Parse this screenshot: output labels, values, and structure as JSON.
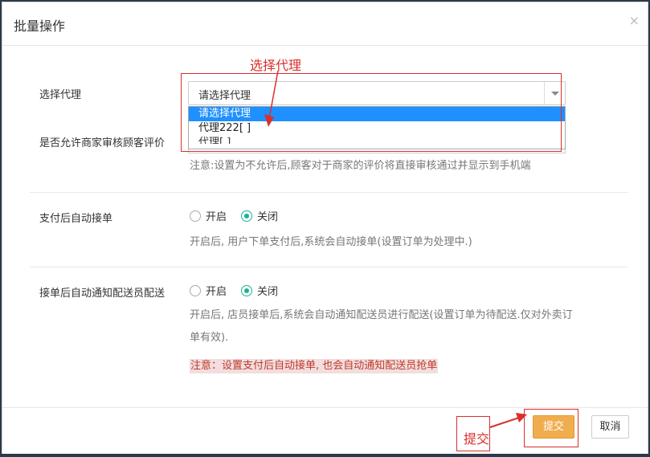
{
  "modal": {
    "title": "批量操作",
    "close_glyph": "×"
  },
  "form": {
    "agent": {
      "label": "选择代理",
      "selected": "请选择代理",
      "options": [
        "请选择代理",
        "代理222[        ]",
        "代理[  ]"
      ]
    },
    "review": {
      "label": "是否允许商家审核顾客评价",
      "note": "注意:设置为不允许后,顾客对于商家的评价将直接审核通过并显示到手机端"
    },
    "auto_accept": {
      "label": "支付后自动接单",
      "on_label": "开启",
      "off_label": "关闭",
      "selected": "off",
      "note": "开启后, 用户下单支付后,系统会自动接单(设置订单为处理中.)"
    },
    "auto_notify": {
      "label": "接单后自动通知配送员配送",
      "on_label": "开启",
      "off_label": "关闭",
      "selected": "off",
      "note_line1": "开启后, 店员接单后,系统会自动通知配送员进行配送(设置订单为待配送.仅对外卖订",
      "note_line2": "单有效).",
      "warning": "注意：设置支付后自动接单, 也会自动通知配送员抢单"
    }
  },
  "footer": {
    "submit_label": "提交",
    "cancel_label": "取消"
  },
  "annotations": {
    "select_callout": "选择代理",
    "submit_callout": "提交",
    "color": "#d9302c"
  },
  "colors": {
    "primary_submit": "#f0ad4e",
    "radio_checked": "#1ab394",
    "dropdown_selected": "#1e90ff"
  }
}
